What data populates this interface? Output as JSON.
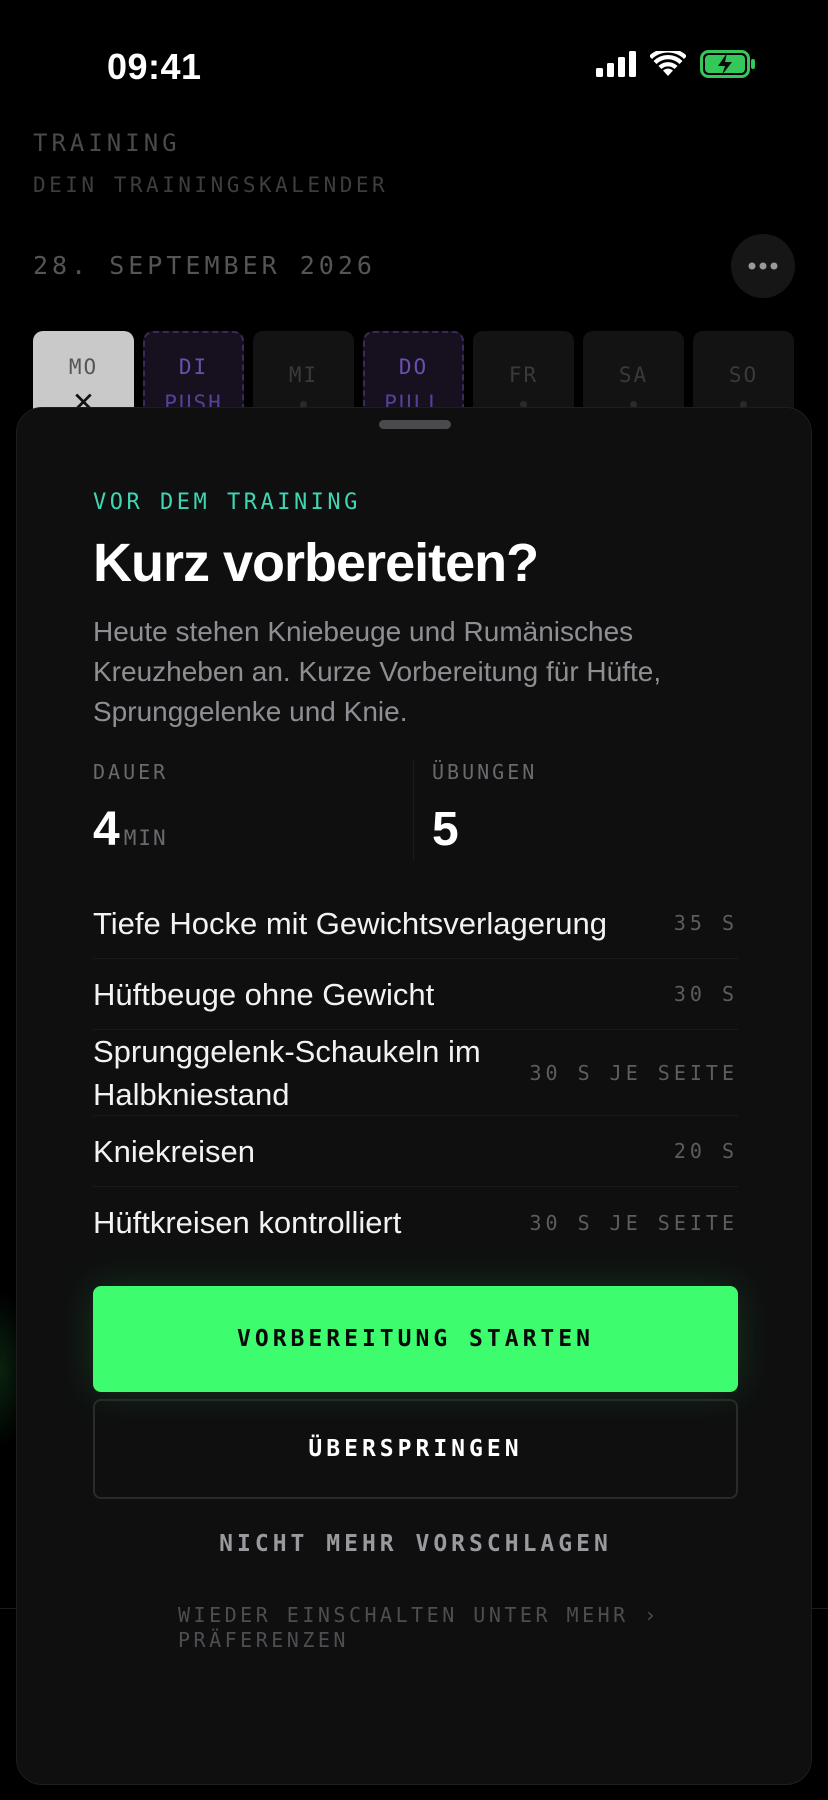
{
  "status_bar": {
    "time": "09:41"
  },
  "background": {
    "title": "TRAINING",
    "subtitle": "DEIN TRAININGSKALENDER",
    "date": "28. SEPTEMBER 2026",
    "days": [
      {
        "label": "MO",
        "state": "active"
      },
      {
        "label": "DI",
        "sub": "PUSH",
        "state": "plan"
      },
      {
        "label": "MI",
        "state": "rest"
      },
      {
        "label": "DO",
        "sub": "PULL",
        "state": "plan"
      },
      {
        "label": "FR",
        "state": "rest"
      },
      {
        "label": "SA",
        "state": "rest"
      },
      {
        "label": "SO",
        "state": "rest"
      }
    ]
  },
  "sheet": {
    "eyebrow": "VOR DEM TRAINING",
    "headline": "Kurz vorbereiten?",
    "description": "Heute stehen Kniebeuge und Rumänisches Kreuzheben an. Kurze Vorbereitung für Hüfte, Sprunggelenke und Knie.",
    "stats": {
      "duration_label": "DAUER",
      "duration_value": "4",
      "duration_unit": "MIN",
      "exercises_label": "ÜBUNGEN",
      "exercises_value": "5"
    },
    "exercises": [
      {
        "name": "Tiefe Hocke mit Gewichtsverlagerung",
        "duration": "35 S"
      },
      {
        "name": "Hüftbeuge ohne Gewicht",
        "duration": "30 S"
      },
      {
        "name": "Sprunggelenk-Schaukeln im Halbkniestand",
        "duration": "30 S JE SEITE"
      },
      {
        "name": "Kniekreisen",
        "duration": "20 S"
      },
      {
        "name": "Hüftkreisen kontrolliert",
        "duration": "30 S JE SEITE"
      }
    ],
    "primary_button": "VORBEREITUNG STARTEN",
    "secondary_button": "ÜBERSPRINGEN",
    "link_button": "NICHT MEHR VORSCHLAGEN",
    "hint": "WIEDER EINSCHALTEN UNTER MEHR › PRÄFERENZEN"
  },
  "colors": {
    "accent_green": "#3dfc6e",
    "eyebrow_teal": "#3fd6b4",
    "plan_purple": "#6b4fb0"
  }
}
